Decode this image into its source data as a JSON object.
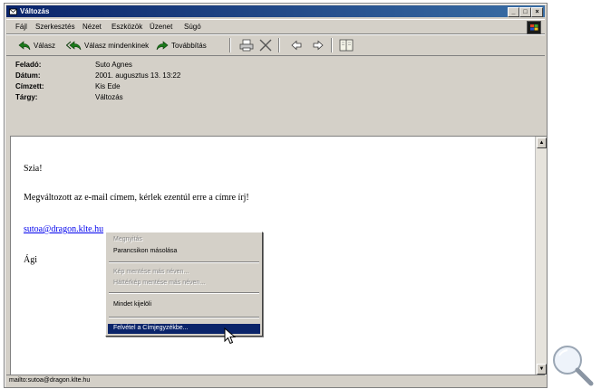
{
  "window": {
    "title": "Változás"
  },
  "menu": [
    "Fájl",
    "Szerkesztés",
    "Nézet",
    "Eszközök",
    "Üzenet",
    "Súgó"
  ],
  "toolbar": {
    "reply": "Válasz",
    "reply_all": "Válasz mindenkinek",
    "forward": "Továbbítás"
  },
  "headers": [
    {
      "label": "Feladó:",
      "value": "Suto Agnes"
    },
    {
      "label": "Dátum:",
      "value": "2001. augusztus 13. 13:22"
    },
    {
      "label": "Címzett:",
      "value": "Kis Ede"
    },
    {
      "label": "Tárgy:",
      "value": "Változás"
    }
  ],
  "message": {
    "greeting": "Szia!",
    "text": "Megváltozott az e-mail címem, kérlek ezentúl erre a címre írj!",
    "link": "sutoa@dragon.klte.hu",
    "signature": "Ági"
  },
  "context_menu": {
    "open": "Megnyitás",
    "copy_shortcut": "Parancsikon másolása",
    "save_picture": "Kép mentése más néven...",
    "save_background": "Háttérkép mentése más néven...",
    "select_all": "Mindet kijelöli",
    "add_to_address_book": "Felvétel a Címjegyzékbe..."
  },
  "status": {
    "text": "mailto:sutoa@dragon.klte.hu"
  }
}
